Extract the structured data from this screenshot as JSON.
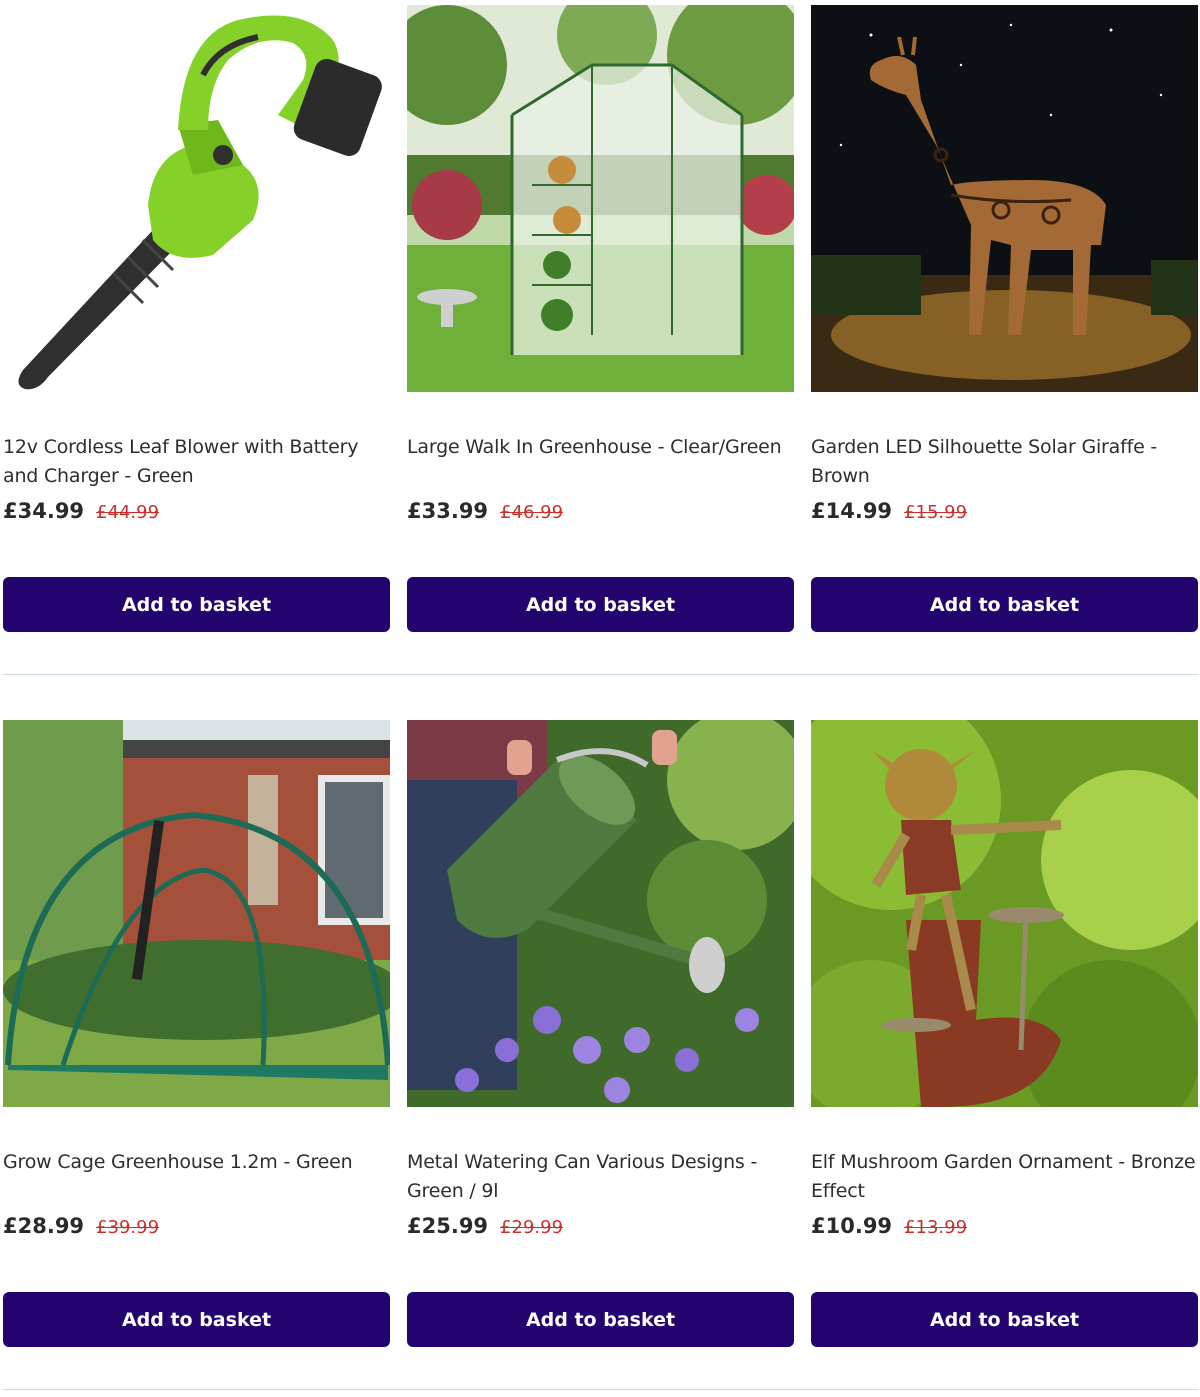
{
  "products": [
    {
      "title": "12v Cordless Leaf Blower with Battery and Charger - Green",
      "price": "£34.99",
      "was_price": "£44.99",
      "button_label": "Add to basket",
      "image": "leaf-blower-image"
    },
    {
      "title": "Large Walk In Greenhouse - Clear/Green",
      "price": "£33.99",
      "was_price": "£46.99",
      "button_label": "Add to basket",
      "image": "greenhouse-image"
    },
    {
      "title": "Garden LED Silhouette Solar Giraffe - Brown",
      "price": "£14.99",
      "was_price": "£15.99",
      "button_label": "Add to basket",
      "image": "giraffe-ornament-image"
    },
    {
      "title": "Grow Cage Greenhouse 1.2m - Green",
      "price": "£28.99",
      "was_price": "£39.99",
      "button_label": "Add to basket",
      "image": "grow-cage-image"
    },
    {
      "title": "Metal Watering Can Various Designs - Green / 9l",
      "price": "£25.99",
      "was_price": "£29.99",
      "button_label": "Add to basket",
      "image": "watering-can-image"
    },
    {
      "title": "Elf Mushroom Garden Ornament - Bronze Effect",
      "price": "£10.99",
      "was_price": "£13.99",
      "button_label": "Add to basket",
      "image": "elf-ornament-image"
    }
  ],
  "colors": {
    "button_bg": "#23046e",
    "button_text": "#ffffff",
    "was_price": "#c9302c",
    "divider": "#cfdde3"
  }
}
